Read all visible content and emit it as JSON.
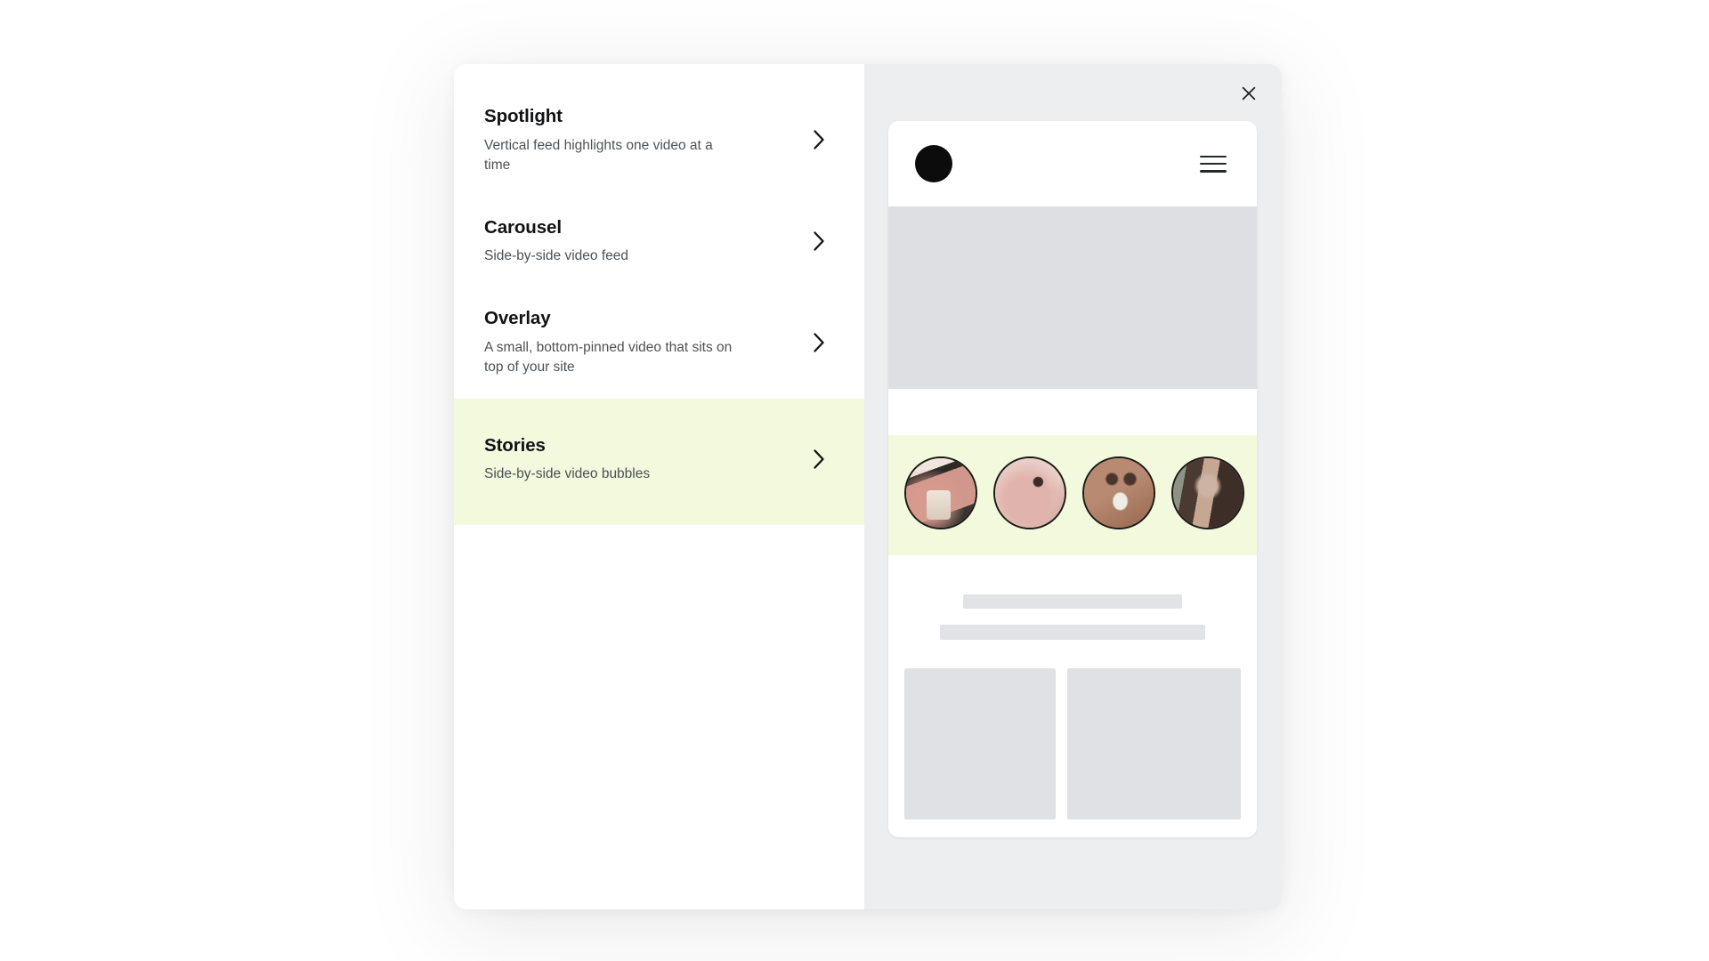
{
  "modal": {
    "close_icon": "close-icon"
  },
  "layout_list": {
    "items": [
      {
        "title": "Spotlight",
        "description": "Vertical feed highlights one video at a time",
        "chevron_icon": "chevron-right-icon",
        "selected": false
      },
      {
        "title": "Carousel",
        "description": "Side-by-side video feed",
        "chevron_icon": "chevron-right-icon",
        "selected": false
      },
      {
        "title": "Overlay",
        "description": "A small, bottom-pinned video that sits on top of your site",
        "chevron_icon": "chevron-right-icon",
        "selected": false
      },
      {
        "title": "Stories",
        "description": "Side-by-side video bubbles",
        "chevron_icon": "chevron-right-icon",
        "selected": true
      }
    ]
  },
  "preview": {
    "site_mock": {
      "logo_icon": "circle-logo-icon",
      "menu_icon": "hamburger-menu-icon",
      "hero_placeholder": "hero-image-placeholder",
      "stories": {
        "highlighted": true,
        "bubbles": [
          {
            "label": "story-bubble-1"
          },
          {
            "label": "story-bubble-2"
          },
          {
            "label": "story-bubble-3"
          },
          {
            "label": "story-bubble-4"
          }
        ]
      },
      "skeleton": {
        "line_1": "text-placeholder-line-1",
        "line_2": "text-placeholder-line-2",
        "block_1": "content-placeholder-block-1",
        "block_2": "content-placeholder-block-2"
      }
    }
  },
  "colors": {
    "highlight_green": "#f2f9dc",
    "panel_grey": "#eceef0",
    "placeholder_grey": "#dedfe3",
    "text_primary": "#111315",
    "text_secondary": "#4c5257"
  }
}
